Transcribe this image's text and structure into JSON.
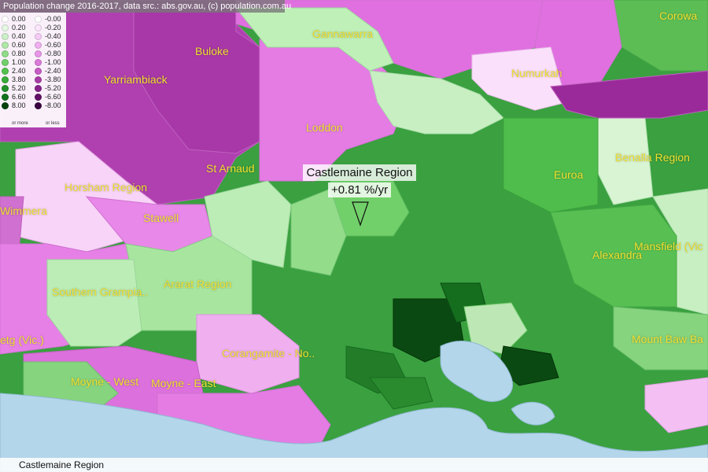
{
  "header": {
    "title": "Population change 2016-2017, data src.: abs.gov.au, (c) population.com.au"
  },
  "legend": {
    "growth": [
      {
        "label": "0.00",
        "color": "#ffffff"
      },
      {
        "label": "0.20",
        "color": "#e6f7e4"
      },
      {
        "label": "0.40",
        "color": "#ccf0c8"
      },
      {
        "label": "0.60",
        "color": "#b0e8a8"
      },
      {
        "label": "0.80",
        "color": "#90dc88"
      },
      {
        "label": "1.00",
        "color": "#72d06a"
      },
      {
        "label": "2.40",
        "color": "#52c24c"
      },
      {
        "label": "3.80",
        "color": "#38ac38"
      },
      {
        "label": "5.20",
        "color": "#22902a"
      },
      {
        "label": "6.60",
        "color": "#11721c"
      },
      {
        "label": "8.00",
        "color": "#04420c"
      }
    ],
    "growth_note": "or more",
    "decline": [
      {
        "label": "-0.00",
        "color": "#ffffff"
      },
      {
        "label": "-0.20",
        "color": "#fbe6fb"
      },
      {
        "label": "-0.40",
        "color": "#f6ccf6"
      },
      {
        "label": "-0.60",
        "color": "#f0b0f0"
      },
      {
        "label": "-0.80",
        "color": "#e896e8"
      },
      {
        "label": "-1.00",
        "color": "#dc7ada"
      },
      {
        "label": "-2.40",
        "color": "#c85cc6"
      },
      {
        "label": "-3.80",
        "color": "#a83ca6"
      },
      {
        "label": "-5.20",
        "color": "#86228a"
      },
      {
        "label": "-6.60",
        "color": "#621266"
      },
      {
        "label": "-8.00",
        "color": "#3a0040"
      }
    ],
    "decline_note": "or less"
  },
  "places": [
    {
      "name": "Gannawarra"
    },
    {
      "name": "Corowa"
    },
    {
      "name": "Buloke"
    },
    {
      "name": "Yarriambiack"
    },
    {
      "name": "Numurkah"
    },
    {
      "name": "Loddon"
    },
    {
      "name": "St Arnaud"
    },
    {
      "name": "Benalla Region"
    },
    {
      "name": "Euroa"
    },
    {
      "name": "Horsham Region"
    },
    {
      "name": "Wimmera"
    },
    {
      "name": "Stawell"
    },
    {
      "name": "Alexandra"
    },
    {
      "name": "Mansfield (Vic"
    },
    {
      "name": "Ararat Region"
    },
    {
      "name": "Southern Grampia.."
    },
    {
      "name": "Mount Baw Ba"
    },
    {
      "name": "Corangamite - No.."
    },
    {
      "name": "Moyne - West"
    },
    {
      "name": "Moyne - East"
    },
    {
      "name": "etg (Vic.)"
    }
  ],
  "selected": {
    "name": "Castlemaine Region",
    "value": "+0.81 %/yr"
  },
  "status": {
    "text": "Castlemaine Region"
  },
  "colors": {
    "sea": "#b4d6ea",
    "growth_high": "#04420c",
    "decline_high": "#b83cb8",
    "label": "#f0e030"
  }
}
